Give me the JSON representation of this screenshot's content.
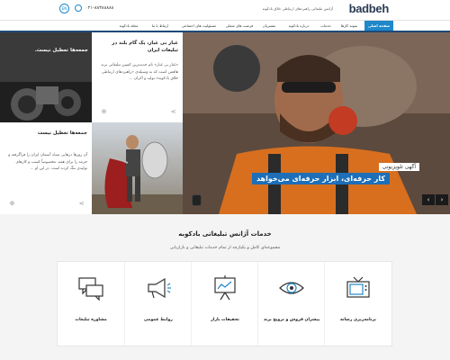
{
  "header": {
    "logo_text": "badbeh",
    "tagline": "آژانس تبلیغاتی راهبردهای ارتباطی خلاق بادکوبه",
    "phone": "۰۲۱-۸۸۳۸۸۸۸۸",
    "lang": "EN"
  },
  "nav": {
    "items": [
      {
        "label": "صفحه اصلی",
        "active": true
      },
      {
        "label": "نمونه کارها"
      },
      {
        "label": "خدمات"
      },
      {
        "label": "درباره بادکوبه"
      },
      {
        "label": "مشتریان"
      },
      {
        "label": "فرصت های شغلی"
      },
      {
        "label": "مسئولیت های اجتماعی"
      },
      {
        "label": "ارتباط با ما"
      },
      {
        "label": "مجله بادکوبه"
      }
    ]
  },
  "hero": {
    "badge": "آگهی تلویزیونی",
    "caption": "کار حرفه‌ای، ابزار حرفه‌ای می‌خواهد",
    "next_arrow": "›",
    "prev_arrow": "‹"
  },
  "cards": {
    "top": {
      "title": "غبار بی غبار، یک گام بلند در تبلیغات ایران",
      "text": "«غبار بی غبار» نام جدیدترین کمپین تبلیغاتی برند هافمن است که به وسیله‌ی «راهبردهای ارتباطی خلاق بادکوبه» تولید و اکران ..."
    },
    "overlay": {
      "title": "جمعه‌ها تعطیل نیست."
    },
    "bottom": {
      "title": "جمعه‌ها تعطیل نیست",
      "text": "آن روزها درهایی سیاه آسمان ایران را فراگرفته و جرمه را برای همه، مخصوصاً کسب و کارهای تولیدی تنگ کرده است. در این او ..."
    },
    "share_icon": "share-icon",
    "link_icon": "link-icon"
  },
  "services": {
    "title": "خدمات آژانس تبلیغاتی بادکوبه",
    "subtitle": "مجموعه‌ای کامل و یکپارچه از تمام خدمات تبلیغاتی و بازاریابی",
    "items": [
      {
        "label": "مشاوره تبلیغات",
        "icon": "chat-bubbles-icon"
      },
      {
        "label": "روابط عمومی",
        "icon": "megaphone-icon"
      },
      {
        "label": "تحقیقات بازار",
        "icon": "presentation-board-icon"
      },
      {
        "label": "پیشران فروش و ترویج برند",
        "icon": "eye-icon"
      },
      {
        "label": "برنامه‌ریزی رسانه",
        "icon": "television-icon"
      }
    ]
  },
  "colors": {
    "accent": "#1e88c9",
    "nav_dark": "#1e4a7a",
    "caption_bg": "#1e6fb8"
  }
}
